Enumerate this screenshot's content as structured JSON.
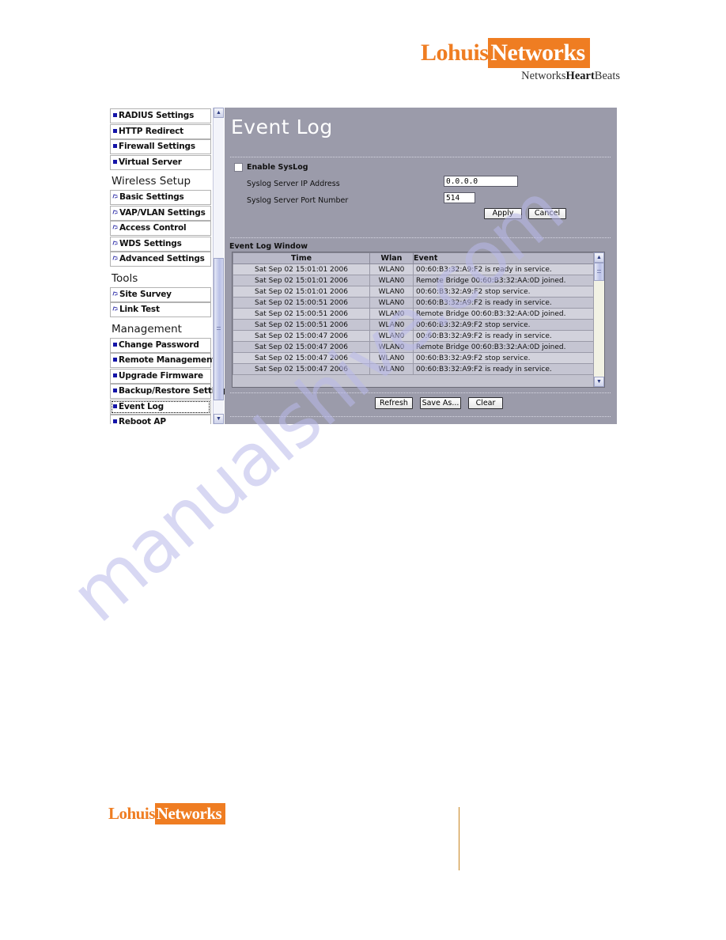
{
  "brand": {
    "logo_part1": "Lohuis",
    "logo_part2": "Networks",
    "tagline_prefix": "Networks",
    "tagline_bold": "Heart",
    "tagline_suffix": "Beats",
    "accent_color": "#ef7d22",
    "footer_rule_color": "#c8851f"
  },
  "watermark": {
    "text": "manualshive.com",
    "color": "#b9b9ea"
  },
  "sidebar": {
    "items_top": [
      {
        "label": "RADIUS Settings",
        "icon": "blue-square-bullet-icon"
      },
      {
        "label": "HTTP Redirect",
        "icon": "blue-square-bullet-icon"
      },
      {
        "label": "Firewall Settings",
        "icon": "blue-square-bullet-icon"
      },
      {
        "label": "Virtual Server",
        "icon": "blue-square-bullet-icon"
      }
    ],
    "section_wireless": "Wireless Setup",
    "items_wireless": [
      {
        "label": "Basic Settings",
        "icon": "antenna-icon"
      },
      {
        "label": "VAP/VLAN Settings",
        "icon": "antenna-icon"
      },
      {
        "label": "Access Control",
        "icon": "antenna-icon"
      },
      {
        "label": "WDS Settings",
        "icon": "antenna-icon"
      },
      {
        "label": "Advanced Settings",
        "icon": "antenna-icon"
      }
    ],
    "section_tools": "Tools",
    "items_tools": [
      {
        "label": "Site Survey",
        "icon": "antenna-icon"
      },
      {
        "label": "Link Test",
        "icon": "antenna-icon"
      }
    ],
    "section_management": "Management",
    "items_management": [
      {
        "label": "Change Password",
        "icon": "blue-square-bullet-icon"
      },
      {
        "label": "Remote Management",
        "icon": "blue-square-bullet-icon"
      },
      {
        "label": "Upgrade Firmware",
        "icon": "blue-square-bullet-icon"
      },
      {
        "label": "Backup/Restore Settings",
        "icon": "blue-square-bullet-icon"
      },
      {
        "label": "Event Log",
        "icon": "blue-square-bullet-icon",
        "selected": true
      },
      {
        "label": "Reboot AP",
        "icon": "blue-square-bullet-icon"
      }
    ],
    "scroll_up_glyph": "▲",
    "scroll_down_glyph": "▼"
  },
  "main": {
    "title": "Event Log",
    "enable_syslog_label": "Enable SysLog",
    "enable_syslog_checked": false,
    "ip_label": "Syslog Server IP Address",
    "ip_value": "0.0.0.0",
    "port_label": "Syslog Server Port Number",
    "port_value": "514",
    "apply_label": "Apply",
    "cancel_label": "Cancel",
    "log_window_label": "Event Log Window",
    "columns": [
      "Time",
      "Wlan",
      "Event"
    ],
    "rows": [
      [
        "Sat Sep 02 15:01:01 2006",
        "WLAN0",
        "00:60:B3:32:A9:F2 is ready in service."
      ],
      [
        "Sat Sep 02 15:01:01 2006",
        "WLAN0",
        "Remote Bridge 00:60:B3:32:AA:0D joined."
      ],
      [
        "Sat Sep 02 15:01:01 2006",
        "WLAN0",
        "00:60:B3:32:A9:F2 stop service."
      ],
      [
        "Sat Sep 02 15:00:51 2006",
        "WLAN0",
        "00:60:B3:32:A9:F2 is ready in service."
      ],
      [
        "Sat Sep 02 15:00:51 2006",
        "WLAN0",
        "Remote Bridge 00:60:B3:32:AA:0D joined."
      ],
      [
        "Sat Sep 02 15:00:51 2006",
        "WLAN0",
        "00:60:B3:32:A9:F2 stop service."
      ],
      [
        "Sat Sep 02 15:00:47 2006",
        "WLAN0",
        "00:60:B3:32:A9:F2 is ready in service."
      ],
      [
        "Sat Sep 02 15:00:47 2006",
        "WLAN0",
        "Remote Bridge 00:60:B3:32:AA:0D joined."
      ],
      [
        "Sat Sep 02 15:00:47 2006",
        "WLAN0",
        "00:60:B3:32:A9:F2 stop service."
      ],
      [
        "Sat Sep 02 15:00:47 2006",
        "WLAN0",
        "00:60:B3:32:A9:F2 is ready in service."
      ]
    ],
    "refresh_label": "Refresh",
    "saveas_label": "Save As...",
    "clear_label": "Clear"
  }
}
